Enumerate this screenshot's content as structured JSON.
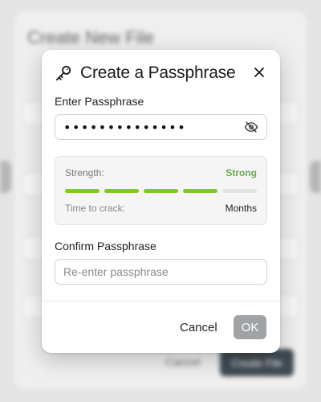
{
  "background_window": {
    "title": "Create New File",
    "cancel_label": "Cancel",
    "create_label": "Create File"
  },
  "dialog": {
    "title": "Create a Passphrase",
    "title_icon": "key-icon",
    "close_icon": "close-icon",
    "passphrase": {
      "label": "Enter Passphrase",
      "value": "••••••••••••••",
      "visibility_icon": "eye-off-icon"
    },
    "strength": {
      "label": "Strength:",
      "value": "Strong",
      "value_color": "#6aa84f",
      "level": 4,
      "max_level": 5,
      "bar_color": "#7cc924",
      "time_label": "Time to crack:",
      "time_value": "Months"
    },
    "confirm": {
      "label": "Confirm Passphrase",
      "value": "",
      "placeholder": "Re-enter passphrase"
    },
    "buttons": {
      "cancel_label": "Cancel",
      "ok_label": "OK",
      "ok_color": "#a0a3a6"
    }
  }
}
